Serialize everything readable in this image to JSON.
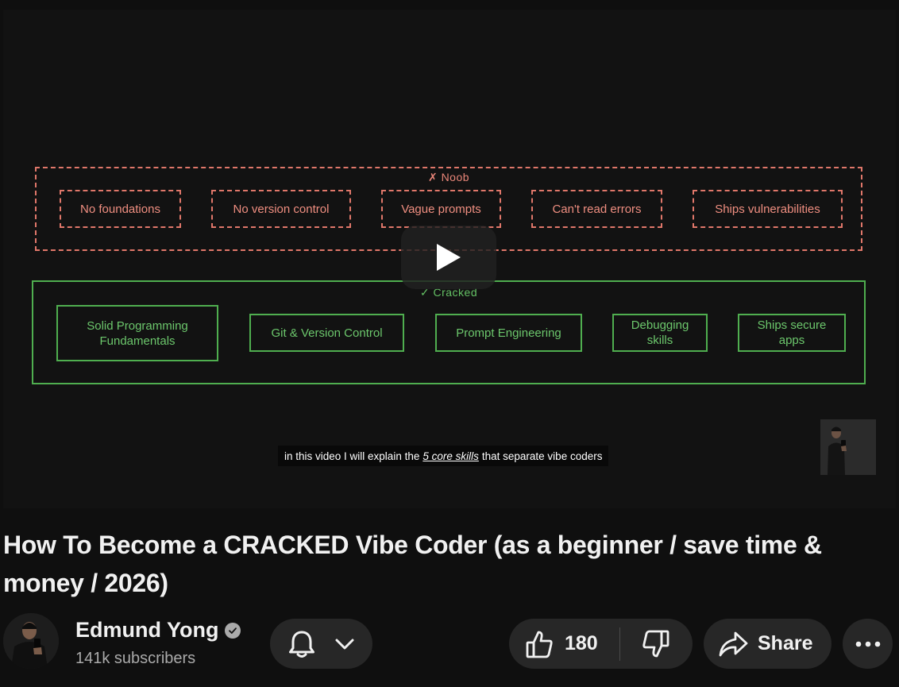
{
  "video": {
    "diagram": {
      "noob_title": "✗ Noob",
      "noob_items": [
        "No foundations",
        "No version control",
        "Vague prompts",
        "Can't read errors",
        "Ships vulnerabilities"
      ],
      "cracked_title": "✓ Cracked",
      "cracked_items": [
        "Solid Programming Fundamentals",
        "Git & Version Control",
        "Prompt Engineering",
        "Debugging skills",
        "Ships secure apps"
      ]
    },
    "caption": {
      "before": "in this video I will explain the",
      "emphasis": "5 core skills",
      "after": "that separate vibe coders"
    },
    "play_icon": "play-icon"
  },
  "title": "How To Become a CRACKED Vibe Coder (as a beginner / save time & money / 2026)",
  "channel": {
    "name": "Edmund Yong",
    "subscribers": "141k subscribers",
    "verified_icon": "verified-check-icon"
  },
  "actions": {
    "bell_icon": "bell-icon",
    "chevron_icon": "chevron-down-icon",
    "like_icon": "thumbs-up-icon",
    "like_count": "180",
    "dislike_icon": "thumbs-down-icon",
    "share_icon": "share-arrow-icon",
    "share_label": "Share",
    "more_icon": "more-horizontal-icon"
  },
  "colors": {
    "background": "#0f0f0f",
    "noob": "#e0776a",
    "cracked": "#4fae4f",
    "pill": "#272727"
  }
}
